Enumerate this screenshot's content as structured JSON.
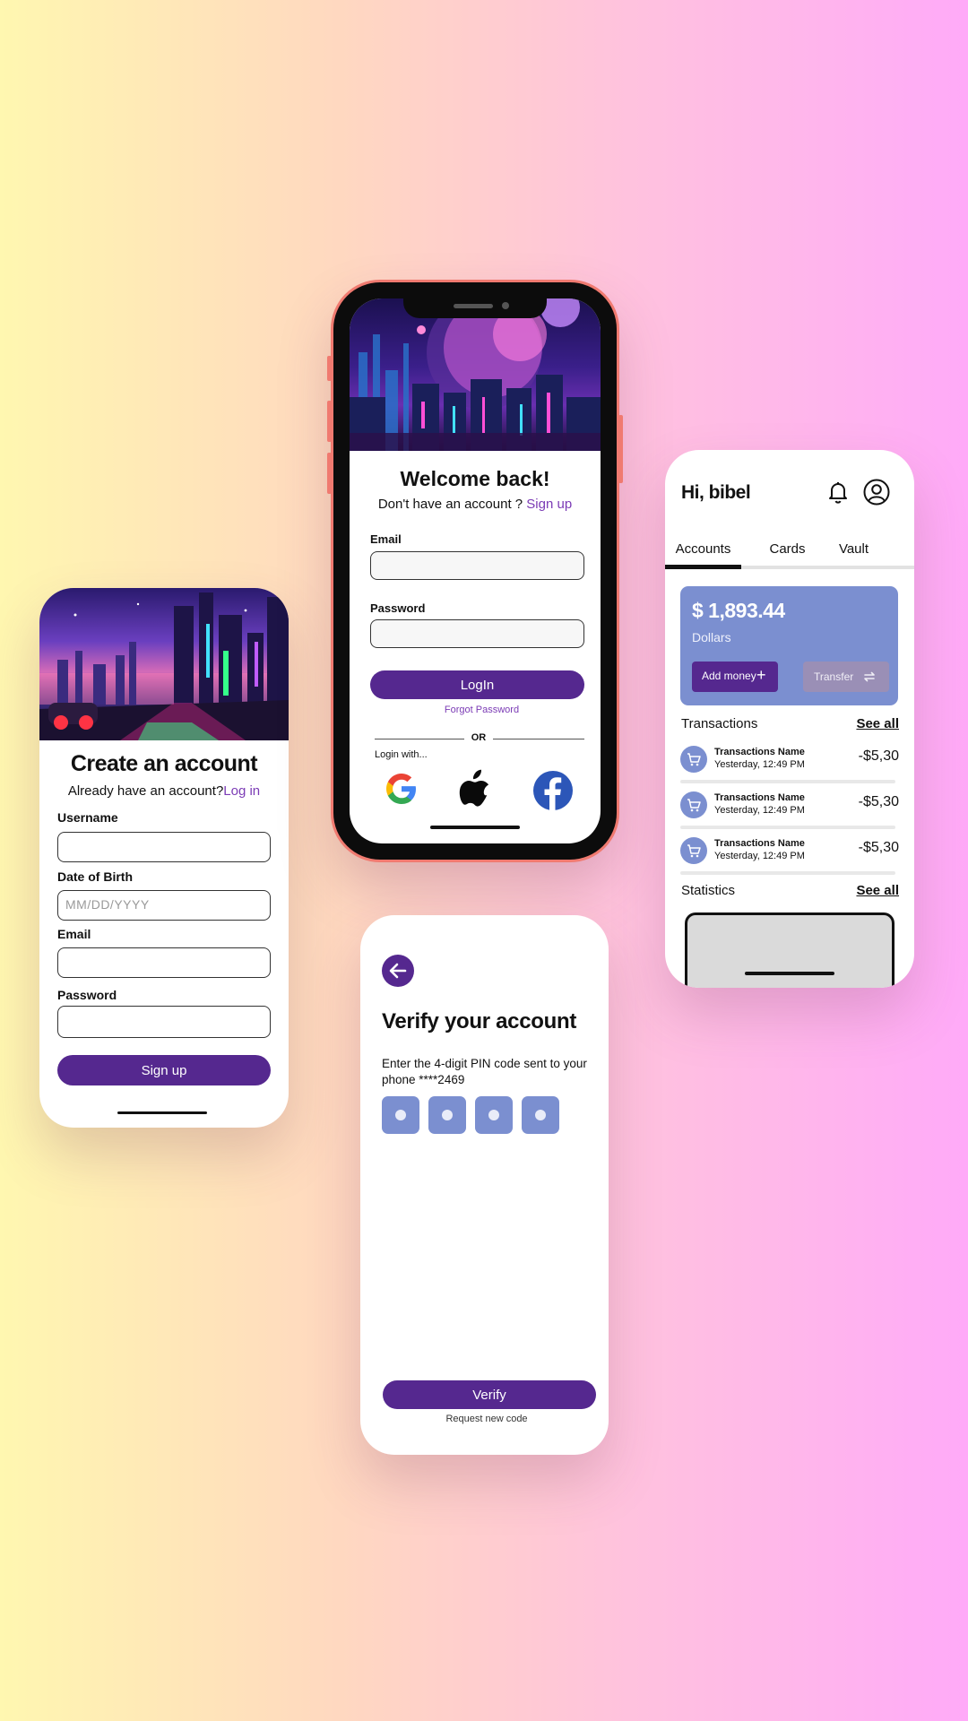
{
  "signup": {
    "title": "Create an account",
    "already": "Already have an account?",
    "login_link": "Log in",
    "username_label": "Username",
    "dob_label": "Date of Birth",
    "dob_placeholder": "MM/DD/YYYY",
    "email_label": "Email",
    "password_label": "Password",
    "submit": "Sign up"
  },
  "login": {
    "title": "Welcome back!",
    "no_account": "Don't have an account ?",
    "signup_link": "Sign up",
    "email_label": "Email",
    "password_label": "Password",
    "submit": "LogIn",
    "forgot": "Forgot Password",
    "or": "OR",
    "login_with": "Login with...",
    "providers": [
      "google-icon",
      "apple-icon",
      "facebook-icon"
    ]
  },
  "verify": {
    "title": "Verify your account",
    "instruction": "Enter the 4-digit PIN code sent to your phone ****2469",
    "submit": "Verify",
    "resend": "Request new code"
  },
  "dashboard": {
    "greeting": "Hi, bibel",
    "tabs": [
      "Accounts",
      "Cards",
      "Vault"
    ],
    "active_tab": "Accounts",
    "balance": "$ 1,893.44",
    "currency": "Dollars",
    "add_money": "Add money",
    "transfer": "Transfer",
    "transactions_title": "Transactions",
    "see_all": "See all",
    "transactions": [
      {
        "name": "Transactions Name",
        "time": "Yesterday, 12:49 PM",
        "amount": "-$5,30"
      },
      {
        "name": "Transactions Name",
        "time": "Yesterday, 12:49 PM",
        "amount": "-$5,30"
      },
      {
        "name": "Transactions Name",
        "time": "Yesterday, 12:49 PM",
        "amount": "-$5,30"
      }
    ],
    "statistics_title": "Statistics",
    "statistics_see_all": "See all"
  },
  "colors": {
    "accent": "#55288f",
    "link": "#7b3bb5",
    "card_blue": "#7b8fd0",
    "phone_frame": "#f07a70"
  }
}
